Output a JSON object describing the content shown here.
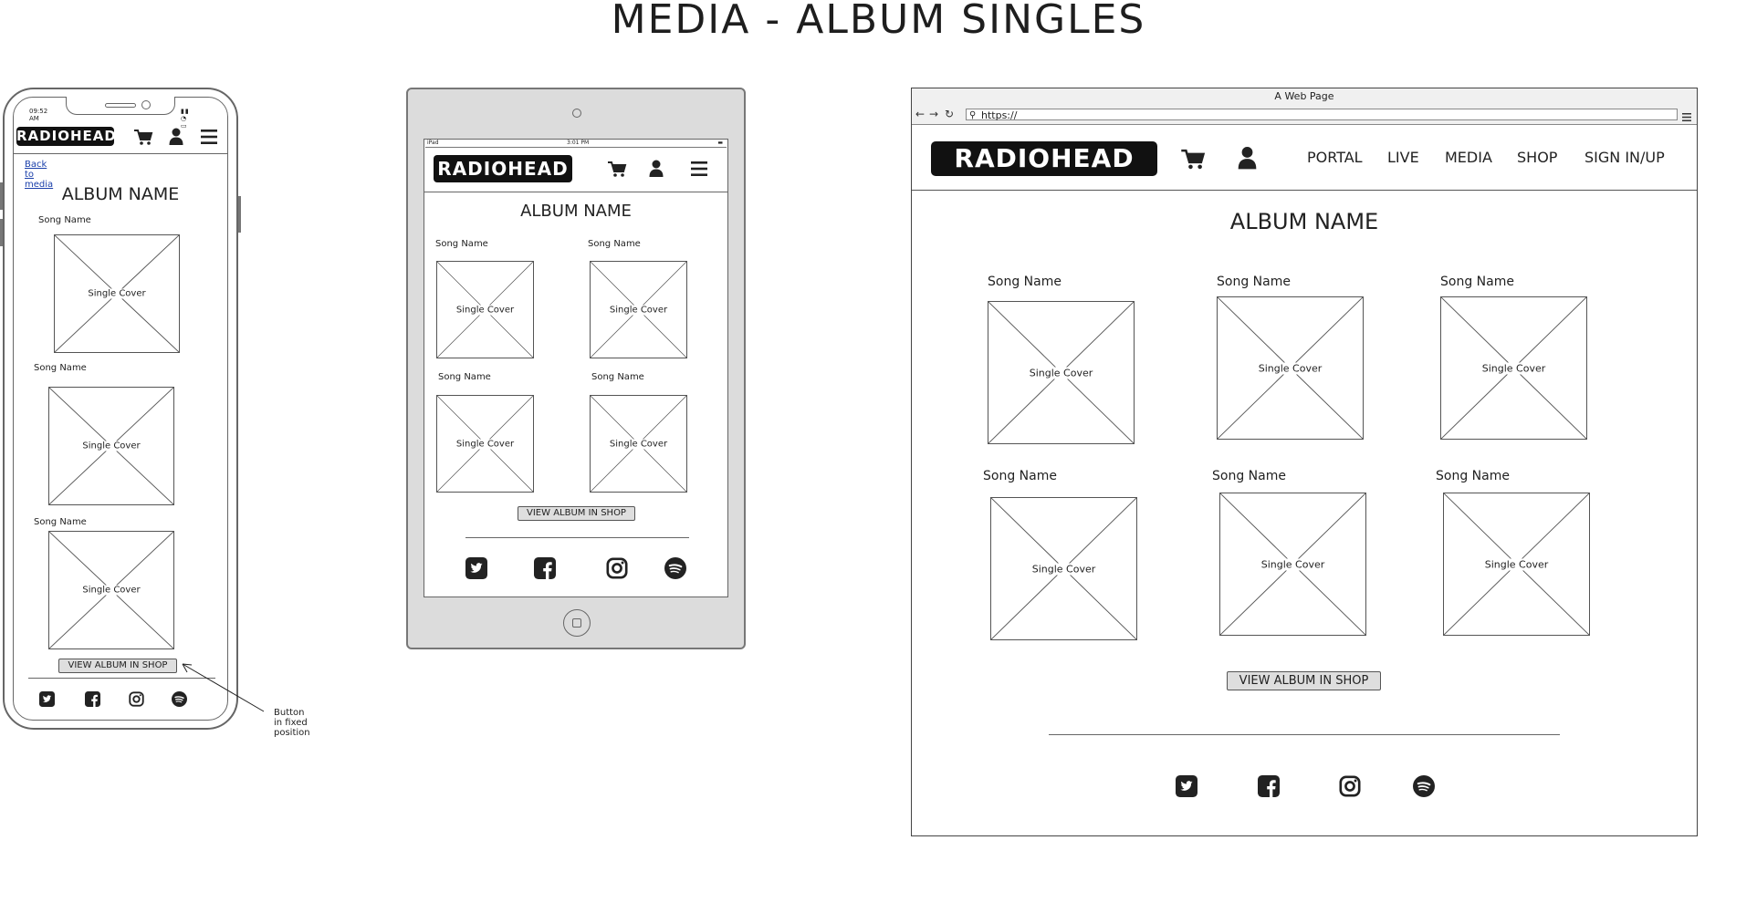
{
  "page": {
    "title": "MEDIA - ALBUM SINGLES"
  },
  "common": {
    "logo_text": "RADIOHEAD",
    "album_name": "ALBUM NAME",
    "song_name": "Song Name",
    "cover_label": "Single Cover",
    "view_album_label": "VIEW ALBUM IN SHOP"
  },
  "mobile": {
    "status_time": "09:52 AM",
    "back_link": "Back to media",
    "annotation": "Button in fixed position"
  },
  "tablet": {
    "status_left": "iPad",
    "status_time": "3:01 PM"
  },
  "desktop": {
    "window_title": "A Web Page",
    "url": "https://",
    "nav": [
      "PORTAL",
      "LIVE",
      "MEDIA",
      "SHOP",
      "SIGN IN/UP"
    ]
  },
  "social_icons": [
    "twitter-icon",
    "facebook-icon",
    "instagram-icon",
    "spotify-icon"
  ],
  "colors": {
    "frame": "#666666",
    "tablet_bezel": "#dcdcdc",
    "logo_bg": "#111111",
    "button_bg": "#dedede"
  }
}
